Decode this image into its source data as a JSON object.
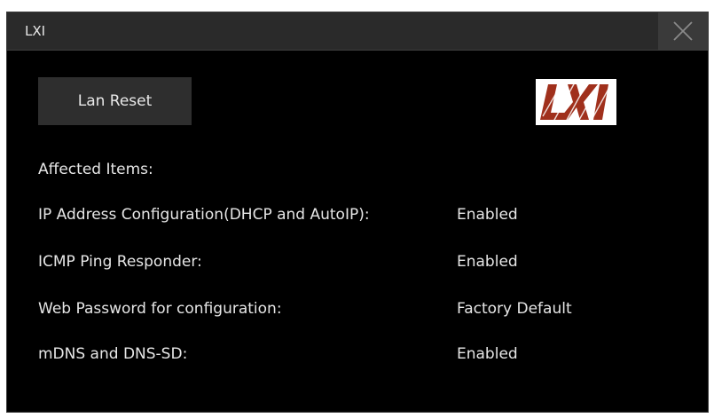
{
  "dialog": {
    "title": "LXI",
    "close_icon": "close-icon",
    "lan_reset_label": "Lan Reset",
    "logo_text": "LXI",
    "logo_colors": {
      "brand": "#a0301c",
      "background": "#ffffff"
    }
  },
  "affected": {
    "heading": "Affected Items:",
    "items": [
      {
        "label": "IP Address Configuration(DHCP and AutoIP):",
        "value": "Enabled"
      },
      {
        "label": "ICMP Ping Responder:",
        "value": "Enabled"
      },
      {
        "label": "Web Password for configuration:",
        "value": "Factory Default"
      },
      {
        "label": "mDNS and DNS-SD:",
        "value": "Enabled"
      }
    ]
  },
  "colors": {
    "background": "#000000",
    "titlebar": "#2a2a2a",
    "button": "#2e2e2e",
    "text": "#e6e6e6"
  }
}
